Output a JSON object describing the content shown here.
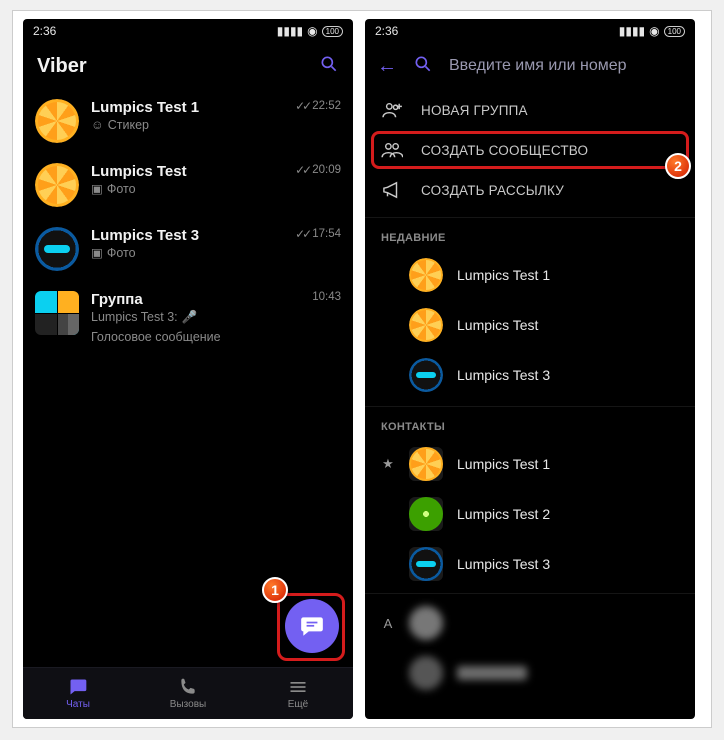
{
  "status": {
    "time": "2:36",
    "battery": "100"
  },
  "left": {
    "app_title": "Viber",
    "chats": [
      {
        "name": "Lumpics Test 1",
        "sub_icon": "☺",
        "sub": "Стикер",
        "time": "22:52",
        "read": true,
        "avatar": "orange"
      },
      {
        "name": "Lumpics Test",
        "sub_icon": "▣",
        "sub": "Фото",
        "time": "20:09",
        "read": true,
        "avatar": "orange"
      },
      {
        "name": "Lumpics Test 3",
        "sub_icon": "▣",
        "sub": "Фото",
        "time": "17:54",
        "read": true,
        "avatar": "blue"
      },
      {
        "name": "Группа",
        "sub_prefix": "Lumpics Test 3:",
        "sub_icon": "🎤",
        "sub": "Голосовое сообщение",
        "time": "10:43",
        "read": false,
        "avatar": "group"
      }
    ],
    "nav": {
      "chats": "Чаты",
      "calls": "Вызовы",
      "more": "Ещё"
    }
  },
  "right": {
    "search_placeholder": "Введите имя или номер",
    "menu": {
      "new_group": "НОВАЯ ГРУППА",
      "new_community": "СОЗДАТЬ СООБЩЕСТВО",
      "new_broadcast": "СОЗДАТЬ РАССЫЛКУ"
    },
    "section_recent": "НЕДАВНИЕ",
    "recent": [
      {
        "name": "Lumpics Test 1",
        "avatar": "orange"
      },
      {
        "name": "Lumpics Test",
        "avatar": "orange"
      },
      {
        "name": "Lumpics Test 3",
        "avatar": "blue"
      }
    ],
    "section_contacts": "КОНТАКТЫ",
    "contacts": [
      {
        "lead": "★",
        "name": "Lumpics Test 1",
        "avatar": "orange"
      },
      {
        "lead": "",
        "name": "Lumpics Test 2",
        "avatar": "lime"
      },
      {
        "lead": "",
        "name": "Lumpics Test 3",
        "avatar": "blue"
      }
    ],
    "letter_header": "A"
  },
  "markers": {
    "one": "1",
    "two": "2"
  }
}
